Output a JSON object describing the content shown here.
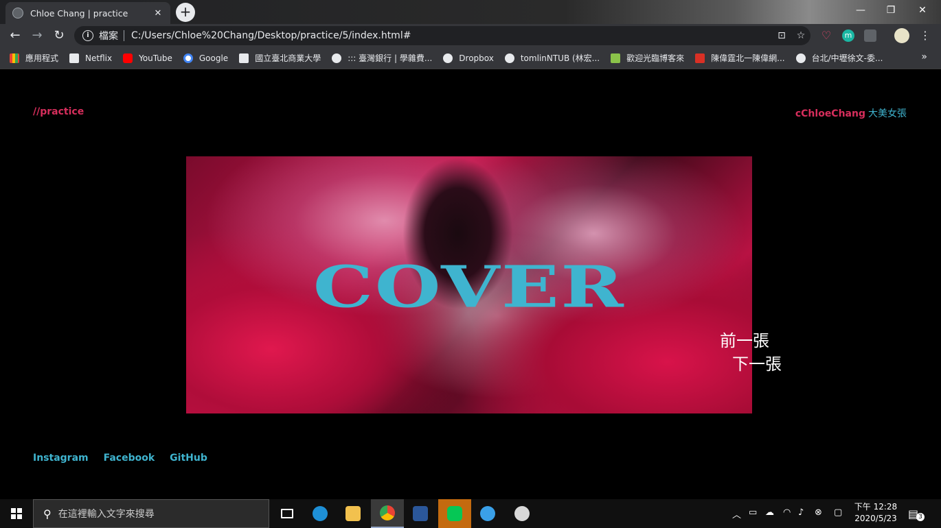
{
  "browser": {
    "tab_title": "Chloe Chang | practice",
    "tab_close": "✕",
    "new_tab": "+",
    "window_controls": {
      "minimize": "—",
      "restore": "❐",
      "close": "✕"
    },
    "nav": {
      "back": "←",
      "forward": "→",
      "reload": "↻"
    },
    "omnibox": {
      "scheme_label": "檔案",
      "url": "C:/Users/Chloe%20Chang/Desktop/practice/5/index.html#"
    },
    "bookmarks": [
      {
        "label": "應用程式",
        "icon": "apps-grid-icon",
        "color": "#4285f4"
      },
      {
        "label": "Netflix",
        "icon": "netflix-icon",
        "color": "#e8eaed"
      },
      {
        "label": "YouTube",
        "icon": "youtube-icon",
        "color": "#ff0000"
      },
      {
        "label": "Google",
        "icon": "google-icon",
        "color": "#ffffff"
      },
      {
        "label": "國立臺北商業大學",
        "icon": "school-icon",
        "color": "#e8eaed"
      },
      {
        "label": "::: 臺灣銀行 | 學雜費...",
        "icon": "globe-icon",
        "color": "#e8eaed"
      },
      {
        "label": "Dropbox",
        "icon": "globe-icon",
        "color": "#e8eaed"
      },
      {
        "label": "tomlinNTUB (林宏...",
        "icon": "github-icon",
        "color": "#e8eaed"
      },
      {
        "label": "歡迎光臨博客來",
        "icon": "books-icon",
        "color": "#8bc34a"
      },
      {
        "label": "陳偉霆北一陳偉網...",
        "icon": "bookmark-icon",
        "color": "#d93025"
      },
      {
        "label": "台北/中壢徐文-委...",
        "icon": "globe-icon",
        "color": "#e8eaed"
      }
    ],
    "bookmarks_more": "»"
  },
  "page": {
    "brand": "//practice",
    "author_name": "cChloeChang",
    "author_nick": "大美女張",
    "hero_title": "COVER",
    "prev_label": "前一張",
    "next_label": "下一張",
    "social": [
      "Instagram",
      "Facebook",
      "GitHub"
    ]
  },
  "taskbar": {
    "search_placeholder": "在這裡輸入文字來搜尋",
    "time": "下午 12:28",
    "date": "2020/5/23",
    "notification_count": "3"
  }
}
